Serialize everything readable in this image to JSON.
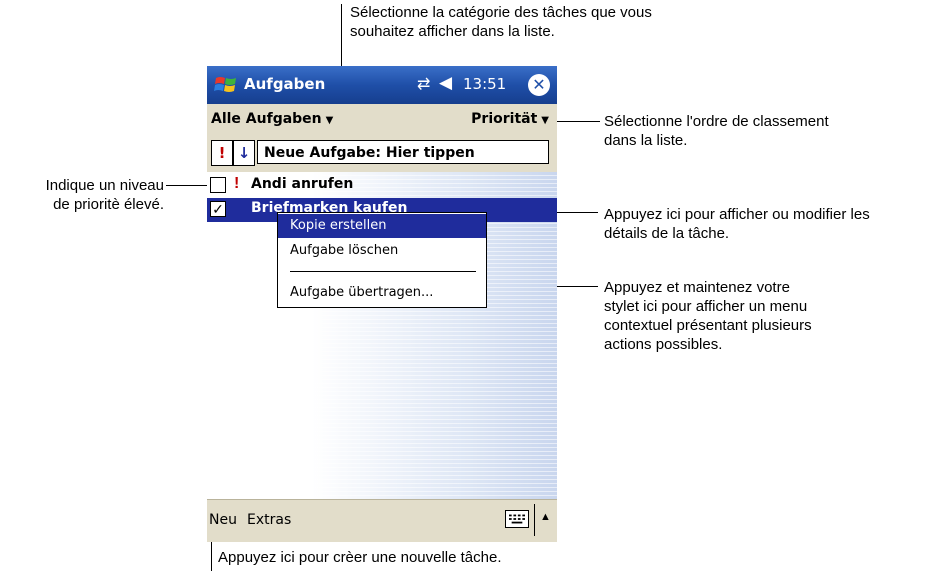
{
  "annotations": {
    "category": "Sélectionne la catégorie des tâches que vous souhaitez afficher dans la liste.",
    "category_l1": "Sélectionne la catégorie des tâches que vous",
    "category_l2": "souhaitez afficher dans la liste.",
    "sort_l1": "Sélectionne l'ordre de classement",
    "sort_l2": "dans la liste.",
    "priority_l1": "Indique un niveau",
    "priority_l2": "de prioritè élevé.",
    "details_l1": "Appuyez ici pour afficher ou modifier les",
    "details_l2": "détails de la tâche.",
    "hold_l1": "Appuyez et maintenez votre",
    "hold_l2": "stylet ici pour afficher un menu",
    "hold_l3": "contextuel présentant plusieurs",
    "hold_l4": "actions possibles.",
    "new_task": "Appuyez ici pour crèer une nouvelle tâche."
  },
  "titlebar": {
    "title": "Aufgaben",
    "time": "13:51",
    "close_label": "✕",
    "connectivity_glyph": "⇄",
    "volume_glyph": "◀"
  },
  "filterbar": {
    "category": "Alle Aufgaben",
    "sort": "Priorität"
  },
  "entrybar": {
    "priority_btn": "!",
    "sort_btn": "↓",
    "input_text": "Neue Aufgabe: Hier tippen"
  },
  "tasks": [
    {
      "text": "Andi anrufen",
      "checked": false,
      "high_priority": true
    },
    {
      "text": "Briefmarken kaufen",
      "checked": true,
      "high_priority": false
    }
  ],
  "context_menu": {
    "items": [
      "Kopie erstellen",
      "Aufgabe löschen",
      "Aufgabe übertragen..."
    ]
  },
  "menubar": {
    "new": "Neu",
    "tools": "Extras"
  },
  "colors": {
    "titlebar": "#1f4fa8",
    "selection": "#1f2c9c",
    "bar": "#e2ddca",
    "priority": "#c00000"
  },
  "icons": [
    "windows-flag-icon",
    "connectivity-icon",
    "volume-icon",
    "close-icon",
    "keyboard-icon",
    "chevron-up-icon",
    "chevron-down-icon"
  ]
}
